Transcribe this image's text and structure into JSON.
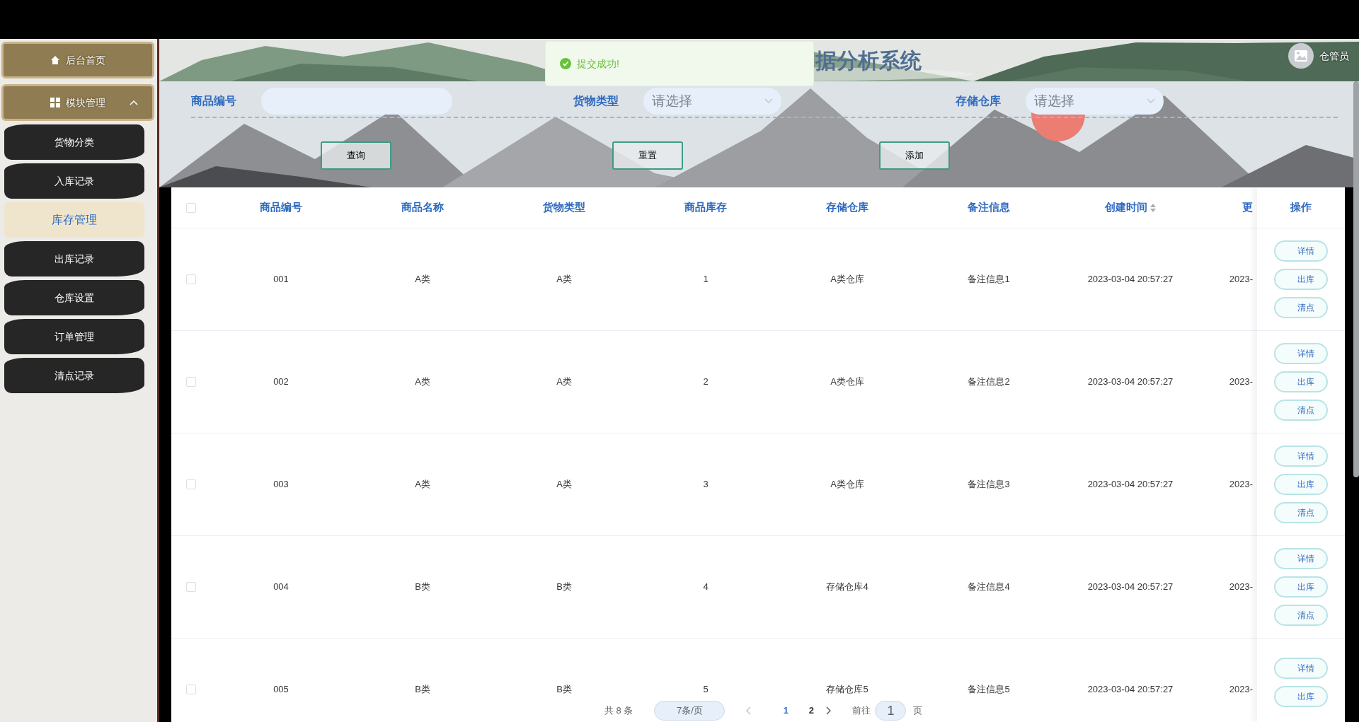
{
  "header": {
    "title_fragment": "据分析系统",
    "user": "仓管员"
  },
  "toast": {
    "message": "提交成功!"
  },
  "sidebar": {
    "home": {
      "label": "后台首页"
    },
    "module": {
      "label": "模块管理",
      "expanded": true,
      "children": [
        {
          "label": "货物分类",
          "selected": false
        },
        {
          "label": "入库记录",
          "selected": false
        },
        {
          "label": "库存管理",
          "selected": true
        },
        {
          "label": "出库记录",
          "selected": false
        },
        {
          "label": "仓库设置",
          "selected": false
        },
        {
          "label": "订单管理",
          "selected": false
        },
        {
          "label": "清点记录",
          "selected": false
        }
      ]
    }
  },
  "search": {
    "fields": [
      {
        "label": "商品编号",
        "kind": "input"
      },
      {
        "label": "货物类型",
        "kind": "select",
        "placeholder": "请选择"
      },
      {
        "label": "存储仓库",
        "kind": "select",
        "placeholder": "请选择"
      }
    ],
    "buttons": [
      "查询",
      "重置",
      "添加"
    ]
  },
  "table": {
    "all_checked": false,
    "columns": [
      {
        "label": "商品编号",
        "sortable": false
      },
      {
        "label": "商品名称",
        "sortable": false
      },
      {
        "label": "货物类型",
        "sortable": false
      },
      {
        "label": "商品库存",
        "sortable": false
      },
      {
        "label": "存储仓库",
        "sortable": false
      },
      {
        "label": "备注信息",
        "sortable": false
      },
      {
        "label": "创建时间",
        "sortable": true
      },
      {
        "label": "更",
        "sortable": false
      }
    ],
    "actions_column": "操作",
    "rows": [
      {
        "checked": false,
        "cells": [
          "001",
          "A类",
          "A类",
          "1",
          "A类仓库",
          "备注信息1",
          "2023-03-04 20:57:27",
          "2023-"
        ],
        "actions": [
          "详情",
          "出库",
          "清点"
        ]
      },
      {
        "checked": false,
        "cells": [
          "002",
          "A类",
          "A类",
          "2",
          "A类仓库",
          "备注信息2",
          "2023-03-04 20:57:27",
          "2023-"
        ],
        "actions": [
          "详情",
          "出库",
          "清点"
        ]
      },
      {
        "checked": false,
        "cells": [
          "003",
          "A类",
          "A类",
          "3",
          "A类仓库",
          "备注信息3",
          "2023-03-04 20:57:27",
          "2023-"
        ],
        "actions": [
          "详情",
          "出库",
          "清点"
        ]
      },
      {
        "checked": false,
        "cells": [
          "004",
          "B类",
          "B类",
          "4",
          "存储仓库4",
          "备注信息4",
          "2023-03-04 20:57:27",
          "2023-"
        ],
        "actions": [
          "详情",
          "出库",
          "清点"
        ]
      },
      {
        "checked": false,
        "cells": [
          "005",
          "B类",
          "B类",
          "5",
          "存储仓库5",
          "备注信息5",
          "2023-03-04 20:57:27",
          "2023-"
        ],
        "actions": [
          "详情",
          "出库"
        ]
      }
    ]
  },
  "pagination": {
    "total": "共 8 条",
    "page_size": "7条/页",
    "pages": [
      {
        "label": "1",
        "selected": true
      },
      {
        "label": "2",
        "selected": false
      }
    ],
    "goto_label": "前往",
    "goto_value": "1",
    "goto_suffix": "页"
  }
}
